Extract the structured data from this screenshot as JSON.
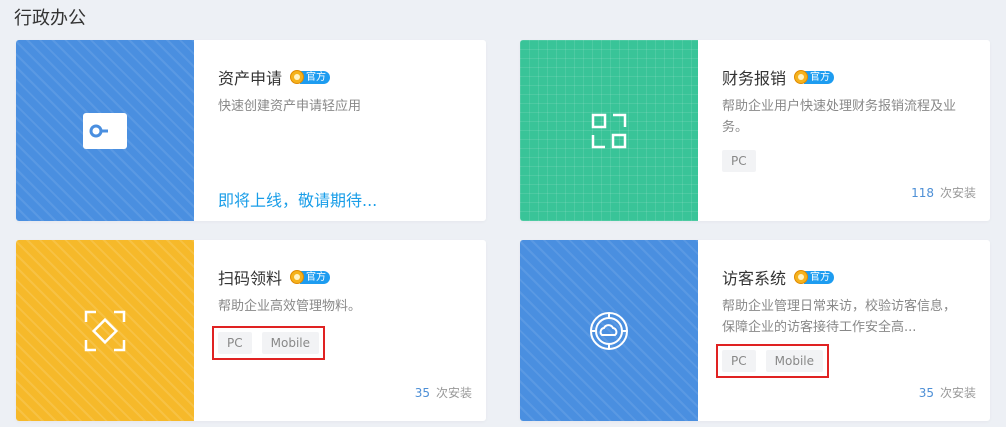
{
  "section": {
    "title": "行政办公"
  },
  "badge": {
    "official_label": "官方"
  },
  "apps": [
    {
      "title": "资产申请",
      "description": "快速创建资产申请轻应用",
      "status": "即将上线，敬请期待...",
      "cover_color": "#4a8fe0",
      "icon": "key-card-icon"
    },
    {
      "title": "财务报销",
      "description": "帮助企业用户快速处理财务报销流程及业务。",
      "platforms": [
        "PC"
      ],
      "install_count": "118",
      "install_label": "次安装",
      "cover_color": "#39c498",
      "icon": "scan-frame-icon"
    },
    {
      "title": "扫码领料",
      "description": "帮助企业高效管理物料。",
      "platforms": [
        "PC",
        "Mobile"
      ],
      "install_count": "35",
      "install_label": "次安装",
      "cover_color": "#f6b92a",
      "icon": "diamond-scan-icon"
    },
    {
      "title": "访客系统",
      "description": "帮助企业管理日常来访，校验访客信息，保障企业的访客接待工作安全高...",
      "platforms": [
        "PC",
        "Mobile"
      ],
      "install_count": "35",
      "install_label": "次安装",
      "cover_color": "#4a8fe0",
      "icon": "globe-cloud-icon"
    }
  ]
}
